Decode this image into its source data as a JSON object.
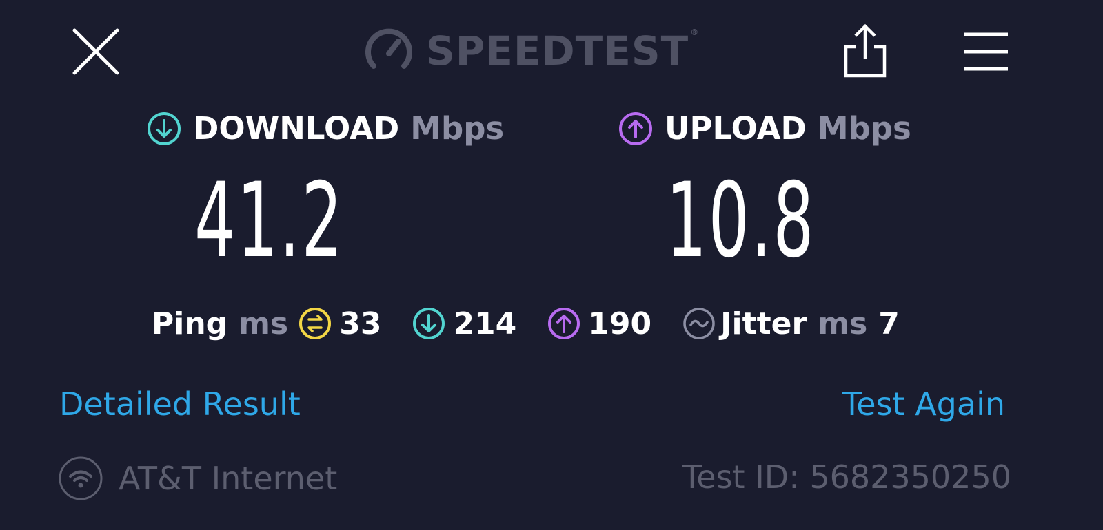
{
  "header": {
    "logo_text": "SPEEDTEST",
    "logo_mark": "®",
    "icons": {
      "close": "close-icon",
      "logo": "gauge-icon",
      "share": "share-icon",
      "menu": "menu-icon"
    }
  },
  "download": {
    "label": "DOWNLOAD",
    "unit": "Mbps",
    "value": "41.2",
    "icon": "arrow-down-circle-icon",
    "color": "#52d4d0"
  },
  "upload": {
    "label": "UPLOAD",
    "unit": "Mbps",
    "value": "10.8",
    "icon": "arrow-up-circle-icon",
    "color": "#b86bf0"
  },
  "ping": {
    "label": "Ping",
    "unit": "ms",
    "idle_value": "33",
    "download_value": "214",
    "upload_value": "190",
    "idle_color": "#f3d645"
  },
  "jitter": {
    "label": "Jitter",
    "unit": "ms",
    "value": "7",
    "icon": "jitter-wave-icon"
  },
  "links": {
    "detailed": "Detailed Result",
    "again": "Test Again",
    "color": "#2fa8e8"
  },
  "footer": {
    "isp": "AT&T Internet",
    "isp_icon": "wifi-icon",
    "test_id": "Test ID: 5682350250"
  }
}
